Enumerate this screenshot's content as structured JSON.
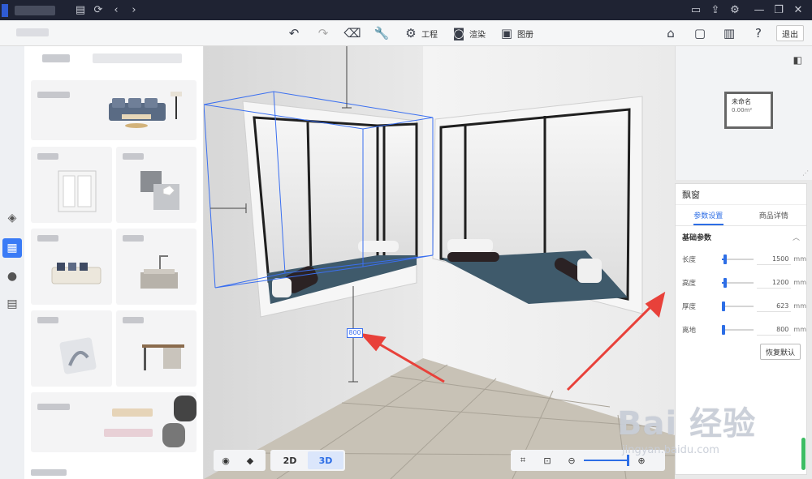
{
  "toolbar": {
    "project_label": "工程",
    "render_label": "渲染",
    "drawing_label": "图册",
    "exit_label": "退出"
  },
  "viewport": {
    "dimension_tag": "800",
    "modes": [
      "2D",
      "3D"
    ],
    "active_mode": "3D"
  },
  "minimap": {
    "room_label": "未命名",
    "room_area": "0.00m²"
  },
  "properties": {
    "title": "飘窗",
    "tabs": [
      "参数设置",
      "商品详情"
    ],
    "active_tab": "参数设置",
    "section_title": "基础参数",
    "params": [
      {
        "label": "长度",
        "value": "1500",
        "unit": "mm",
        "fraction": 0.12
      },
      {
        "label": "高度",
        "value": "1200",
        "unit": "mm",
        "fraction": 0.1
      },
      {
        "label": "厚度",
        "value": "623",
        "unit": "mm",
        "fraction": 0.05
      },
      {
        "label": "离地",
        "value": "800",
        "unit": "mm",
        "fraction": 0.06
      }
    ],
    "reset_label": "恢复默认"
  },
  "watermark": {
    "main": "Bai 经验",
    "sub": "jingyan.baidu.com"
  },
  "colors": {
    "accent": "#2d6ee6",
    "titlebar": "#1f2333",
    "annotation_arrow": "#e8413a"
  }
}
